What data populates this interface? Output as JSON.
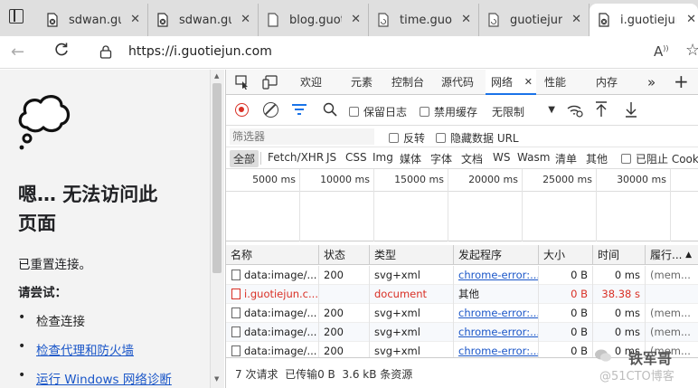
{
  "browser": {
    "tabs": [
      {
        "title": "sdwan.guc",
        "active": false
      },
      {
        "title": "sdwan.guc",
        "active": false
      },
      {
        "title": "blog.guoti",
        "active": false
      },
      {
        "title": "time.guoti",
        "active": false
      },
      {
        "title": "guotiejun",
        "active": false
      },
      {
        "title": "i.guotiejun",
        "active": true
      }
    ],
    "url": "https://i.guotiejun.com"
  },
  "error_page": {
    "heading": "嗯… 无法访问此页面",
    "heading_line1": "嗯… 无法访问此",
    "heading_line2": "页面",
    "message": "已重置连接。",
    "try_label": "请尝试：",
    "suggestions": [
      {
        "text": "检查连接",
        "link": false
      },
      {
        "text": "检查代理和防火墙",
        "link": true
      },
      {
        "text": "运行 Windows 网络诊断",
        "link": true
      }
    ]
  },
  "devtools": {
    "tabs": [
      "欢迎",
      "元素",
      "控制台",
      "源代码",
      "网络",
      "性能",
      "内存"
    ],
    "active_tab": "网络",
    "toolbar": {
      "preserve_log": "保留日志",
      "disable_cache": "禁用缓存",
      "throttling": "无限制"
    },
    "filter": {
      "placeholder": "筛选器",
      "invert": "反转",
      "hide_data_urls": "隐藏数据 URL"
    },
    "type_filters": [
      "全部",
      "Fetch/XHR",
      "JS",
      "CSS",
      "Img",
      "媒体",
      "字体",
      "文档",
      "WS",
      "Wasm",
      "清单",
      "其他"
    ],
    "blocked_label": "已阻止 Cook",
    "timeline_ticks": [
      "5000 ms",
      "10000 ms",
      "15000 ms",
      "20000 ms",
      "25000 ms",
      "30000 ms"
    ],
    "columns": [
      "名称",
      "状态",
      "类型",
      "发起程序",
      "大小",
      "时间",
      "履行..."
    ],
    "rows": [
      {
        "name": "data:image/...",
        "status": "200",
        "type": "svg+xml",
        "initiator": "chrome-error:...",
        "size": "0 B",
        "time": "0 ms",
        "fulfilled": "(mem...",
        "error": false
      },
      {
        "name": "i.guotiejun.c...",
        "status": "",
        "type": "document",
        "initiator": "其他",
        "size": "0 B",
        "time": "38.38 s",
        "fulfilled": "",
        "error": true
      },
      {
        "name": "data:image/...",
        "status": "200",
        "type": "svg+xml",
        "initiator": "chrome-error:...",
        "size": "0 B",
        "time": "0 ms",
        "fulfilled": "(mem...",
        "error": false
      },
      {
        "name": "data:image/...",
        "status": "200",
        "type": "svg+xml",
        "initiator": "chrome-error:...",
        "size": "0 B",
        "time": "0 ms",
        "fulfilled": "(mem...",
        "error": false
      },
      {
        "name": "data:image/...",
        "status": "200",
        "type": "svg+xml",
        "initiator": "chrome-error:...",
        "size": "0 B",
        "time": "0 ms",
        "fulfilled": "(mem...",
        "error": false
      }
    ],
    "status_summary": "7 次请求  已传输0 B  3.6 kB 条资源"
  },
  "watermark": {
    "name": "铁军哥",
    "source": "@51CTO博客"
  },
  "colors": {
    "accent": "#1a73e8",
    "error": "#d93025",
    "link": "#1a56c8",
    "record": "#d93025"
  }
}
